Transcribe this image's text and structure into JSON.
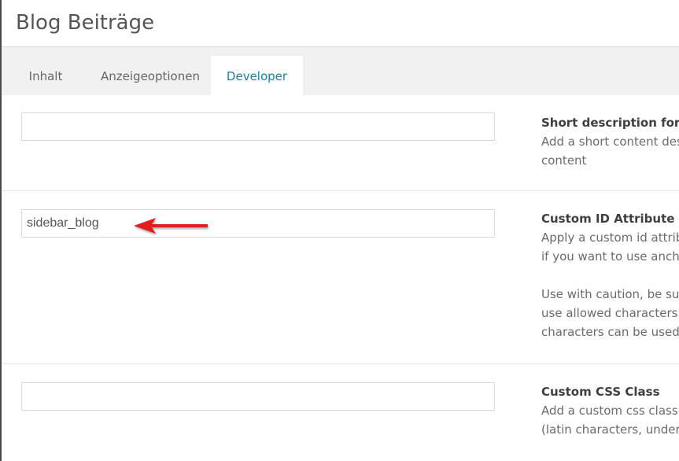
{
  "header": {
    "title": "Blog Beiträge"
  },
  "tabs": [
    {
      "label": "Inhalt",
      "active": false
    },
    {
      "label": "Anzeigeoptionen",
      "active": false
    },
    {
      "label": "Developer",
      "active": true
    }
  ],
  "fields": [
    {
      "value": "",
      "title": "Short description for ba",
      "lines": [
        "Add a short content desc",
        "content"
      ]
    },
    {
      "value": "sidebar_blog",
      "title": "Custom ID Attribute",
      "lines": [
        "Apply a custom id attribu",
        "if you want to use ancho"
      ],
      "lines2": [
        "Use with caution, be sure",
        "use allowed characters (l",
        "characters can be used)."
      ]
    },
    {
      "value": "",
      "title": "Custom CSS Class",
      "lines": [
        "Add a custom css class fo",
        "(latin characters, undersc"
      ]
    }
  ],
  "annotation": {
    "arrow_color": "#e31b1b",
    "icon": "red-arrow-left-icon"
  },
  "colors": {
    "tab_active_text": "#1a7ea5",
    "tabbar_background": "#f1f1f1"
  }
}
